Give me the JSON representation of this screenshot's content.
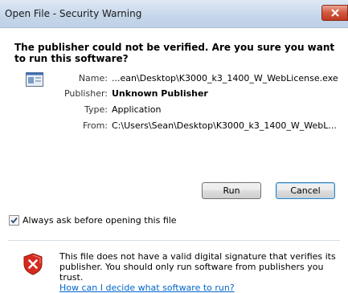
{
  "window": {
    "title": "Open File - Security Warning"
  },
  "headline": "The publisher could not be verified.  Are you sure you want to run this software?",
  "fields": {
    "name_label": "Name:",
    "name_value": "...ean\\Desktop\\K3000_k3_1400_W_WebLicense.exe",
    "publisher_label": "Publisher:",
    "publisher_value": "Unknown Publisher",
    "type_label": "Type:",
    "type_value": "Application",
    "from_label": "From:",
    "from_value": "C:\\Users\\Sean\\Desktop\\K3000_k3_1400_W_WebL..."
  },
  "buttons": {
    "run": "Run",
    "cancel": "Cancel"
  },
  "checkbox": {
    "label": "Always ask before opening this file",
    "checked": true
  },
  "warning": {
    "text": "This file does not have a valid digital signature that verifies its publisher.  You should only run software from publishers you trust.",
    "link": "How can I decide what software to run?"
  },
  "colors": {
    "link": "#0066cc",
    "close_button": "#c03a20",
    "shield_red": "#d62a1e"
  }
}
